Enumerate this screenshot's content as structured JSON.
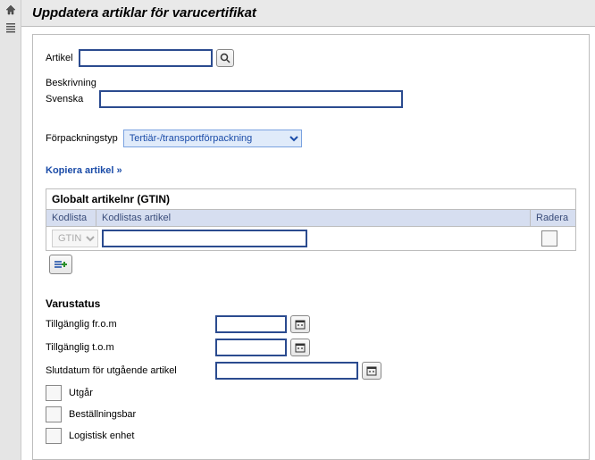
{
  "header": {
    "title": "Uppdatera artiklar för varucertifikat"
  },
  "form": {
    "artikel_label": "Artikel",
    "artikel_value": "",
    "beskrivning_label": "Beskrivning",
    "svenska_label": "Svenska",
    "svenska_value": "",
    "forpackningstyp_label": "Förpackningstyp",
    "forpackningstyp_value": "Tertiär-/transportförpackning",
    "forpackningstyp_options": [
      "Tertiär-/transportförpackning"
    ],
    "kopiera_link": "Kopiera artikel »"
  },
  "gtin": {
    "group_title": "Globalt artikelnr (GTIN)",
    "col_kodlista": "Kodlista",
    "col_kodlistas_artikel": "Kodlistas artikel",
    "col_radera": "Radera",
    "row": {
      "kodlista_value": "GTIN",
      "artikel_value": ""
    }
  },
  "status": {
    "section_title": "Varustatus",
    "tillg_from_label": "Tillgänglig fr.o.m",
    "tillg_from_value": "",
    "tillg_tom_label": "Tillgänglig t.o.m",
    "tillg_tom_value": "",
    "slutdatum_label": "Slutdatum för utgående artikel",
    "slutdatum_value": "",
    "utgar_label": "Utgår",
    "bestallningsbar_label": "Beställningsbar",
    "logistisk_label": "Logistisk enhet"
  },
  "icons": {
    "home": "home-icon",
    "list": "list-icon",
    "search": "search-icon",
    "calendar": "calendar-icon",
    "add_row": "add-row-icon",
    "delete": "delete-icon"
  }
}
